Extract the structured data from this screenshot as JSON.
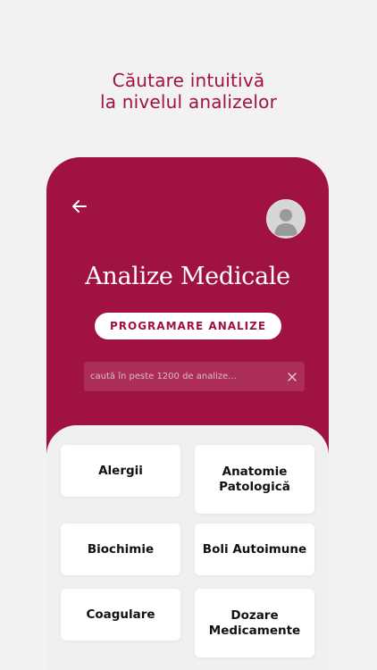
{
  "promo": {
    "line1": "Căutare intuitivă",
    "line2": "la nivelul analizelor"
  },
  "screen": {
    "title": "Analize Medicale",
    "program_button": "PROGRAMARE ANALIZE",
    "search_placeholder": "caută în peste 1200 de analize..."
  },
  "categories": [
    "Alergii",
    "Anatomie\nPatologică",
    "Biochimie",
    "Boli Autoimune",
    "Coagulare",
    "Dozare\nMedicamente"
  ],
  "colors": {
    "brand": "#a01144",
    "background": "#f3f2f2"
  }
}
